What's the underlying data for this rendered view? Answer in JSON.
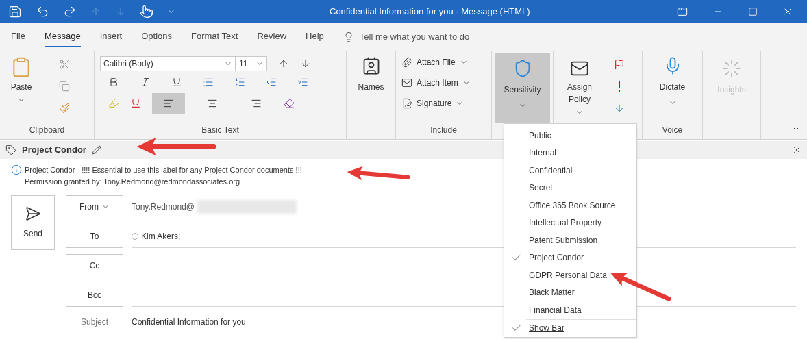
{
  "window": {
    "title": "Confidential Information for you  -  Message (HTML)"
  },
  "tabs": [
    {
      "label": "File",
      "selected": false
    },
    {
      "label": "Message",
      "selected": true
    },
    {
      "label": "Insert",
      "selected": false
    },
    {
      "label": "Options",
      "selected": false
    },
    {
      "label": "Format Text",
      "selected": false
    },
    {
      "label": "Review",
      "selected": false
    },
    {
      "label": "Help",
      "selected": false
    }
  ],
  "tell_me": {
    "placeholder": "Tell me what you want to do"
  },
  "ribbon": {
    "clipboard": {
      "label": "Clipboard",
      "paste": "Paste"
    },
    "basic_text": {
      "label": "Basic Text",
      "font": "Calibri (Body)",
      "size": "11",
      "alignments": [
        {
          "kind": "left",
          "selected": true
        },
        {
          "kind": "center",
          "selected": false
        },
        {
          "kind": "right",
          "selected": false
        }
      ]
    },
    "names": {
      "label": "Names"
    },
    "include": {
      "label": "Include",
      "buttons": [
        {
          "kind": "file",
          "label": "Attach File"
        },
        {
          "kind": "item",
          "label": "Attach Item"
        },
        {
          "kind": "signature",
          "label": "Signature"
        }
      ]
    },
    "sensitivity": {
      "label": "Sensitivity",
      "expanded": true
    },
    "assign_policy": {
      "label": "Assign Policy"
    },
    "voice": {
      "label": "Voice",
      "button": "Dictate"
    },
    "insights": {
      "label": "Insights",
      "disabled": true
    }
  },
  "label_bar": {
    "label": "Project Condor"
  },
  "label_info": [
    "Project Condor - !!!! Essential to use this label for any Project Condor documents !!!",
    "Permission granted by: Tony.Redmond@redmondassociates.org"
  ],
  "send": "Send",
  "fields": [
    {
      "label": "From",
      "value": "Tony.Redmond@",
      "redacted": true
    },
    {
      "label": "To",
      "value": "Kim Akers;"
    },
    {
      "label": "Cc"
    },
    {
      "label": "Bcc"
    }
  ],
  "subject": {
    "label": "Subject",
    "value": "Confidential Information for you"
  },
  "sensitivity_menu": [
    {
      "label": "Public",
      "checked": false
    },
    {
      "label": "Internal",
      "checked": false
    },
    {
      "label": "Confidential",
      "checked": false
    },
    {
      "label": "Secret",
      "checked": false
    },
    {
      "label": "Office 365 Book Source",
      "checked": false
    },
    {
      "label": "Intellectual Property",
      "checked": false
    },
    {
      "label": "Patent Submission",
      "checked": false
    },
    {
      "label": "Project Condor",
      "checked": true
    },
    {
      "label": "GDPR Personal Data",
      "checked": false
    },
    {
      "label": "Black Matter",
      "checked": false
    },
    {
      "label": "Financial Data",
      "checked": false
    },
    {
      "label": "Show Bar",
      "checked": true,
      "kind": "toggle"
    }
  ]
}
